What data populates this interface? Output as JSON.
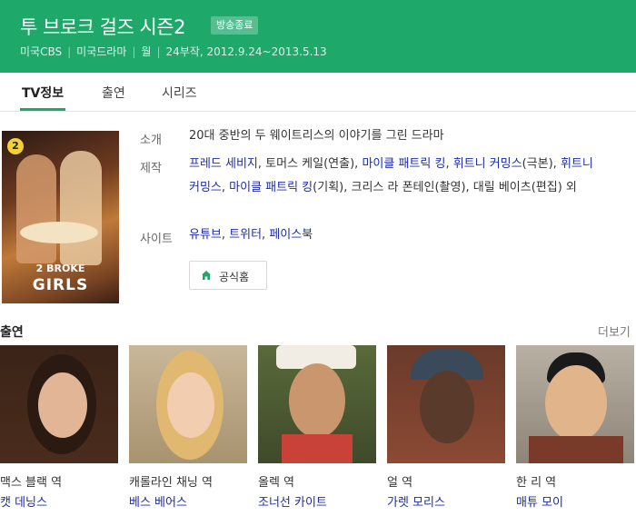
{
  "header": {
    "title": "투 브로크 걸즈 시즌2",
    "badge": "방송종료",
    "meta": [
      "미국CBS",
      "미국드라마",
      "월",
      "24부작, 2012.9.24~2013.5.13"
    ],
    "bg_color": "#1ea96b"
  },
  "tabs": [
    {
      "label": "TV정보",
      "active": true
    },
    {
      "label": "출연",
      "active": false
    },
    {
      "label": "시리즈",
      "active": false
    }
  ],
  "poster": {
    "badge": "2",
    "logo_line1": "2 BROKE",
    "logo_line2": "GIRLS"
  },
  "info": {
    "intro_label": "소개",
    "intro_text": "20대 중반의 두 웨이트리스의 이야기를 그린 드라마",
    "production_label": "제작",
    "production": [
      {
        "text": "프레드 세비지",
        "link": true
      },
      {
        "text": ", 토머스 케일(연출), ",
        "link": false
      },
      {
        "text": "마이클 패트릭 킹",
        "link": true
      },
      {
        "text": ", ",
        "link": false
      },
      {
        "text": "휘트니 커밍스",
        "link": true
      },
      {
        "text": "(극본), ",
        "link": false
      },
      {
        "text": "휘트니 커밍스",
        "link": true
      },
      {
        "text": ", ",
        "link": false
      },
      {
        "text": "마이클 패트릭 킹",
        "link": true
      },
      {
        "text": "(기획), 크리스 라 폰테인(촬영), 대릴 베이츠(편집) 외",
        "link": false
      }
    ],
    "site_label": "사이트",
    "sites": [
      "유튜브",
      "트위터",
      "페이스북"
    ],
    "home_button": "공식홈"
  },
  "cast": {
    "title": "출연",
    "more": "더보기",
    "members": [
      {
        "role": "맥스 블랙 역",
        "name": "캣 데닝스"
      },
      {
        "role": "캐롤라인 채닝 역",
        "name": "베스 베어스"
      },
      {
        "role": "올렉 역",
        "name": "조너선 카이트"
      },
      {
        "role": "얼 역",
        "name": "가렛 모리스"
      },
      {
        "role": "한 리 역",
        "name": "매튜 모이"
      }
    ]
  }
}
